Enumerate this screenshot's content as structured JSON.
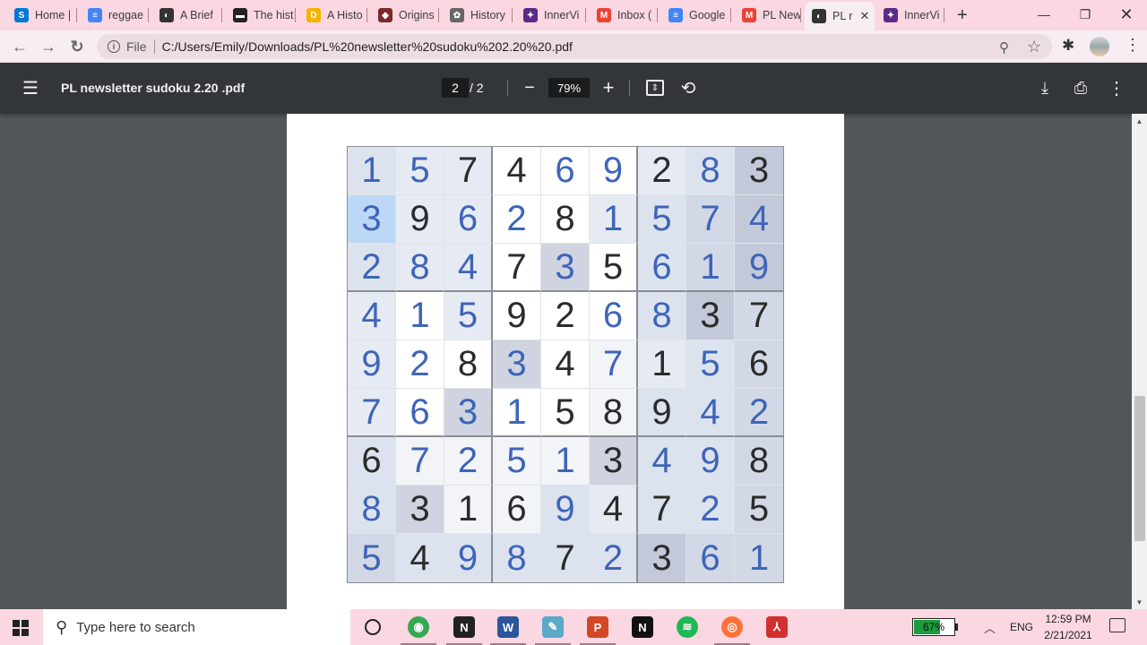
{
  "tabs": [
    {
      "label": "Home |",
      "icon": "skype-icon",
      "color": "#0078d4",
      "glyph": "S"
    },
    {
      "label": "reggae",
      "icon": "docs-icon",
      "color": "#4285f4",
      "glyph": "≡"
    },
    {
      "label": "A Brief",
      "icon": "globe-icon",
      "color": "#333333",
      "glyph": "◐"
    },
    {
      "label": "The hist",
      "icon": "bbc-icon",
      "color": "#222222",
      "glyph": "▬"
    },
    {
      "label": "A Histo",
      "icon": "coin-icon",
      "color": "#f4b400",
      "glyph": "D"
    },
    {
      "label": "Origins",
      "icon": "flag-icon",
      "color": "#7a2a2a",
      "glyph": "◆"
    },
    {
      "label": "History",
      "icon": "ornament-icon",
      "color": "#666666",
      "glyph": "✿"
    },
    {
      "label": "InnerVi",
      "icon": "innervision-icon",
      "color": "#5b2a86",
      "glyph": "✦"
    },
    {
      "label": "Inbox (",
      "icon": "gmail-icon",
      "color": "#ea4335",
      "glyph": "M"
    },
    {
      "label": "Google",
      "icon": "docs-icon",
      "color": "#4285f4",
      "glyph": "≡"
    },
    {
      "label": "PL New",
      "icon": "gmail-icon",
      "color": "#ea4335",
      "glyph": "M"
    },
    {
      "label": "PL r",
      "icon": "globe-icon",
      "color": "#333333",
      "glyph": "◐",
      "active": true
    },
    {
      "label": "InnerVi",
      "icon": "innervision-icon",
      "color": "#5b2a86",
      "glyph": "✦"
    }
  ],
  "address": {
    "scheme": "File",
    "url": "C:/Users/Emily/Downloads/PL%20newsletter%20sudoku%202.20%20.pdf"
  },
  "pdf": {
    "title": "PL newsletter sudoku 2.20 .pdf",
    "page_current": "2",
    "page_total": "/  2",
    "zoom": "79%"
  },
  "sudoku": {
    "rows": [
      [
        "1",
        "5",
        "7",
        "4",
        "6",
        "9",
        "2",
        "8",
        "3"
      ],
      [
        "3",
        "9",
        "6",
        "2",
        "8",
        "1",
        "5",
        "7",
        "4"
      ],
      [
        "2",
        "8",
        "4",
        "7",
        "3",
        "5",
        "6",
        "1",
        "9"
      ],
      [
        "4",
        "1",
        "5",
        "9",
        "2",
        "6",
        "8",
        "3",
        "7"
      ],
      [
        "9",
        "2",
        "8",
        "3",
        "4",
        "7",
        "1",
        "5",
        "6"
      ],
      [
        "7",
        "6",
        "3",
        "1",
        "5",
        "8",
        "9",
        "4",
        "2"
      ],
      [
        "6",
        "7",
        "2",
        "5",
        "1",
        "3",
        "4",
        "9",
        "8"
      ],
      [
        "8",
        "3",
        "1",
        "6",
        "9",
        "4",
        "7",
        "2",
        "5"
      ],
      [
        "5",
        "4",
        "9",
        "8",
        "7",
        "2",
        "3",
        "6",
        "1"
      ]
    ],
    "given": [
      [
        0,
        0,
        1,
        1,
        0,
        0,
        1,
        0,
        1
      ],
      [
        0,
        1,
        0,
        0,
        1,
        0,
        0,
        0,
        0
      ],
      [
        0,
        0,
        0,
        1,
        0,
        1,
        0,
        0,
        0
      ],
      [
        0,
        0,
        0,
        1,
        1,
        0,
        0,
        1,
        1
      ],
      [
        0,
        0,
        1,
        0,
        1,
        0,
        1,
        0,
        1
      ],
      [
        0,
        0,
        0,
        0,
        1,
        1,
        1,
        0,
        0
      ],
      [
        1,
        0,
        0,
        0,
        0,
        1,
        0,
        0,
        1
      ],
      [
        0,
        1,
        1,
        1,
        0,
        1,
        1,
        0,
        1
      ],
      [
        0,
        1,
        0,
        0,
        1,
        0,
        1,
        0,
        0
      ]
    ],
    "shades": [
      [
        "#dde3ee",
        "#e6eaf2",
        "#e6eaf2",
        "#ffffff",
        "#ffffff",
        "#ffffff",
        "#e6eaf2",
        "#dde3ee",
        "#c3c9d8"
      ],
      [
        "#bcd8f6",
        "#e6eaf2",
        "#e6eaf2",
        "#ffffff",
        "#ffffff",
        "#e6eaf2",
        "#dde3ee",
        "#d2d8e6",
        "#c3c9d8"
      ],
      [
        "#dde3ee",
        "#e6eaf2",
        "#e6eaf2",
        "#ffffff",
        "#cfd4e0",
        "#ffffff",
        "#dde3ee",
        "#d2d8e6",
        "#c3c9d8"
      ],
      [
        "#e6eaf2",
        "#ffffff",
        "#e6eaf2",
        "#ffffff",
        "#ffffff",
        "#ffffff",
        "#dde3ee",
        "#c3c9d8",
        "#d2d8e6"
      ],
      [
        "#e6eaf2",
        "#ffffff",
        "#ffffff",
        "#cfd4e0",
        "#ffffff",
        "#f2f4f8",
        "#e6eaf2",
        "#dde3ee",
        "#d2d8e6"
      ],
      [
        "#e6eaf2",
        "#ffffff",
        "#cfd4e0",
        "#ffffff",
        "#ffffff",
        "#f2f4f8",
        "#dde3ee",
        "#dde3ee",
        "#d2d8e6"
      ],
      [
        "#dde3ee",
        "#f2f4f8",
        "#f2f4f8",
        "#f2f4f8",
        "#f2f4f8",
        "#cfd4e0",
        "#dde3ee",
        "#dde3ee",
        "#d2d8e6"
      ],
      [
        "#dde3ee",
        "#cfd4e0",
        "#f2f4f8",
        "#f2f4f8",
        "#dde3ee",
        "#e6eaf2",
        "#dde3ee",
        "#dde3ee",
        "#d2d8e6"
      ],
      [
        "#d2d8e6",
        "#dde3ee",
        "#dde3ee",
        "#dde3ee",
        "#dde3ee",
        "#dde3ee",
        "#c3c9d8",
        "#d2d8e6",
        "#d2d8e6"
      ]
    ]
  },
  "taskbar": {
    "search_placeholder": "Type here to search",
    "apps": [
      {
        "name": "cortana-icon",
        "color": "transparent",
        "glyph": "O"
      },
      {
        "name": "chrome-icon",
        "color": "#34a853",
        "glyph": "◉"
      },
      {
        "name": "notion-icon",
        "color": "#222222",
        "glyph": "N"
      },
      {
        "name": "word-icon",
        "color": "#2b579a",
        "glyph": "W"
      },
      {
        "name": "notepad-icon",
        "color": "#5aa9c9",
        "glyph": "✎"
      },
      {
        "name": "powerpoint-icon",
        "color": "#d24726",
        "glyph": "P"
      },
      {
        "name": "netflix-icon",
        "color": "#111111",
        "glyph": "N"
      },
      {
        "name": "spotify-icon",
        "color": "#1db954",
        "glyph": "≋"
      },
      {
        "name": "firefox-icon",
        "color": "#ff7139",
        "glyph": "◎"
      },
      {
        "name": "acrobat-icon",
        "color": "#d32f2f",
        "glyph": "⅄"
      }
    ],
    "battery": "67%",
    "battery_level": 0.67,
    "language": "ENG",
    "time": "12:59 PM",
    "date": "2/21/2021"
  }
}
